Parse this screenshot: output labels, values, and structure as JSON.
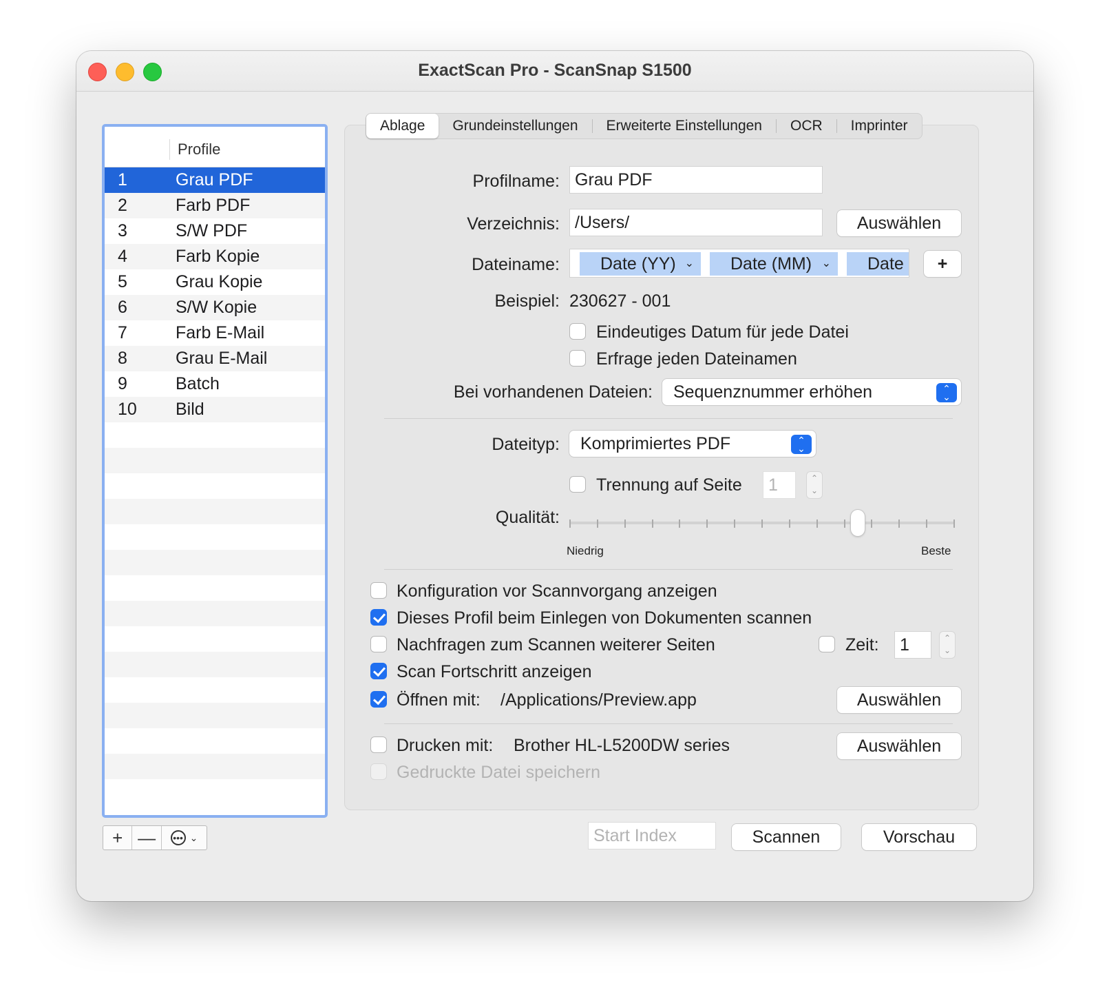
{
  "window": {
    "title": "ExactScan Pro - ScanSnap S1500"
  },
  "profiles": {
    "header": "Profile",
    "selected_index": 0,
    "items": [
      {
        "num": "1",
        "name": "Grau PDF"
      },
      {
        "num": "2",
        "name": "Farb PDF"
      },
      {
        "num": "3",
        "name": "S/W PDF"
      },
      {
        "num": "4",
        "name": "Farb Kopie"
      },
      {
        "num": "5",
        "name": "Grau Kopie"
      },
      {
        "num": "6",
        "name": "S/W Kopie"
      },
      {
        "num": "7",
        "name": "Farb E-Mail"
      },
      {
        "num": "8",
        "name": "Grau E-Mail"
      },
      {
        "num": "9",
        "name": "Batch"
      },
      {
        "num": "10",
        "name": "Bild"
      }
    ],
    "add_label": "+",
    "remove_label": "—",
    "more_label": "⋯"
  },
  "tabs": [
    {
      "label": "Ablage",
      "active": true
    },
    {
      "label": "Grundeinstellungen"
    },
    {
      "label": "Erweiterte Einstellungen"
    },
    {
      "label": "OCR"
    },
    {
      "label": "Imprinter"
    }
  ],
  "form": {
    "profilname_label": "Profilname:",
    "profilname_value": "Grau PDF",
    "verzeichnis_label": "Verzeichnis:",
    "verzeichnis_value": "/Users/",
    "choose_label": "Auswählen",
    "dateiname_label": "Dateiname:",
    "tokens": [
      "Date (YY)",
      "Date (MM)",
      "Date"
    ],
    "add_token_label": "+",
    "beispiel_label": "Beispiel:",
    "beispiel_value": "230627 - 001",
    "unique_date_label": "Eindeutiges Datum für jede Datei",
    "ask_name_label": "Erfrage jeden Dateinamen",
    "existing_label": "Bei vorhandenen Dateien:",
    "existing_value": "Sequenznummer erhöhen",
    "dateityp_label": "Dateityp:",
    "dateityp_value": "Komprimiertes PDF",
    "split_label": "Trennung auf Seite",
    "split_value": "1",
    "quality_label": "Qualität:",
    "quality_min": "Niedrig",
    "quality_max": "Beste",
    "quality_level": 0.75,
    "config_label": "Konfiguration vor Scannvorgang anzeigen",
    "scan_on_insert_label": "Dieses Profil beim Einlegen von Dokumenten scannen",
    "ask_more_label": "Nachfragen zum Scannen weiterer Seiten",
    "zeit_label": "Zeit:",
    "zeit_value": "1",
    "progress_label": "Scan Fortschritt anzeigen",
    "open_with_label": "Öffnen mit:",
    "open_with_value": "/Applications/Preview.app",
    "print_with_label": "Drucken mit:",
    "print_with_value": "Brother HL-L5200DW series",
    "save_printed_label": "Gedruckte Datei speichern"
  },
  "footer": {
    "start_index_placeholder": "Start Index",
    "scan_label": "Scannen",
    "preview_label": "Vorschau"
  }
}
